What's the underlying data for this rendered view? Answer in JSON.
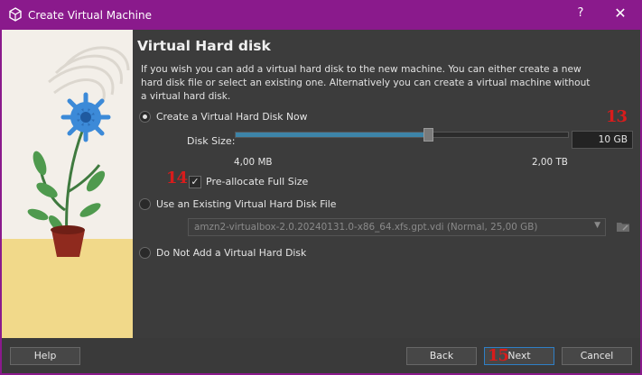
{
  "window": {
    "title": "Create Virtual Machine",
    "help_glyph": "?",
    "close_glyph": "✕"
  },
  "page": {
    "heading": "Virtual Hard disk",
    "description": "If you wish you can add a virtual hard disk to the new machine. You can either create a new hard disk file or select an existing one. Alternatively you can create a virtual machine without a virtual hard disk."
  },
  "options": {
    "create": {
      "label": "Create a Virtual Hard Disk Now",
      "selected": true
    },
    "existing": {
      "label": "Use an Existing Virtual Hard Disk File",
      "selected": false
    },
    "none": {
      "label": "Do Not Add a Virtual Hard Disk",
      "selected": false
    }
  },
  "disk": {
    "size_label": "Disk Size:",
    "size_value": "10 GB",
    "min_label": "4,00 MB",
    "max_label": "2,00 TB",
    "slider_fraction": 0.58,
    "preallocate_label": "Pre-allocate Full Size",
    "preallocate_checked": true,
    "check_glyph": "✓"
  },
  "existing_file": {
    "value": "amzn2-virtualbox-2.0.20240131.0-x86_64.xfs.gpt.vdi (Normal, 25,00 GB)"
  },
  "annotations": {
    "a13": "13",
    "a14": "14",
    "a15": "15"
  },
  "buttons": {
    "help": "Help",
    "back": "Back",
    "next": "Next",
    "cancel": "Cancel"
  },
  "colors": {
    "titlebar": "#8a1a8c",
    "slider_fill": "#3d84a8",
    "annotation": "#d81c1c",
    "default_button_border": "#2f7fc6"
  },
  "icons": {
    "app": "virtualbox-cube-icon",
    "folder": "folder-browse-icon",
    "dropdown": "chevron-down-icon"
  }
}
